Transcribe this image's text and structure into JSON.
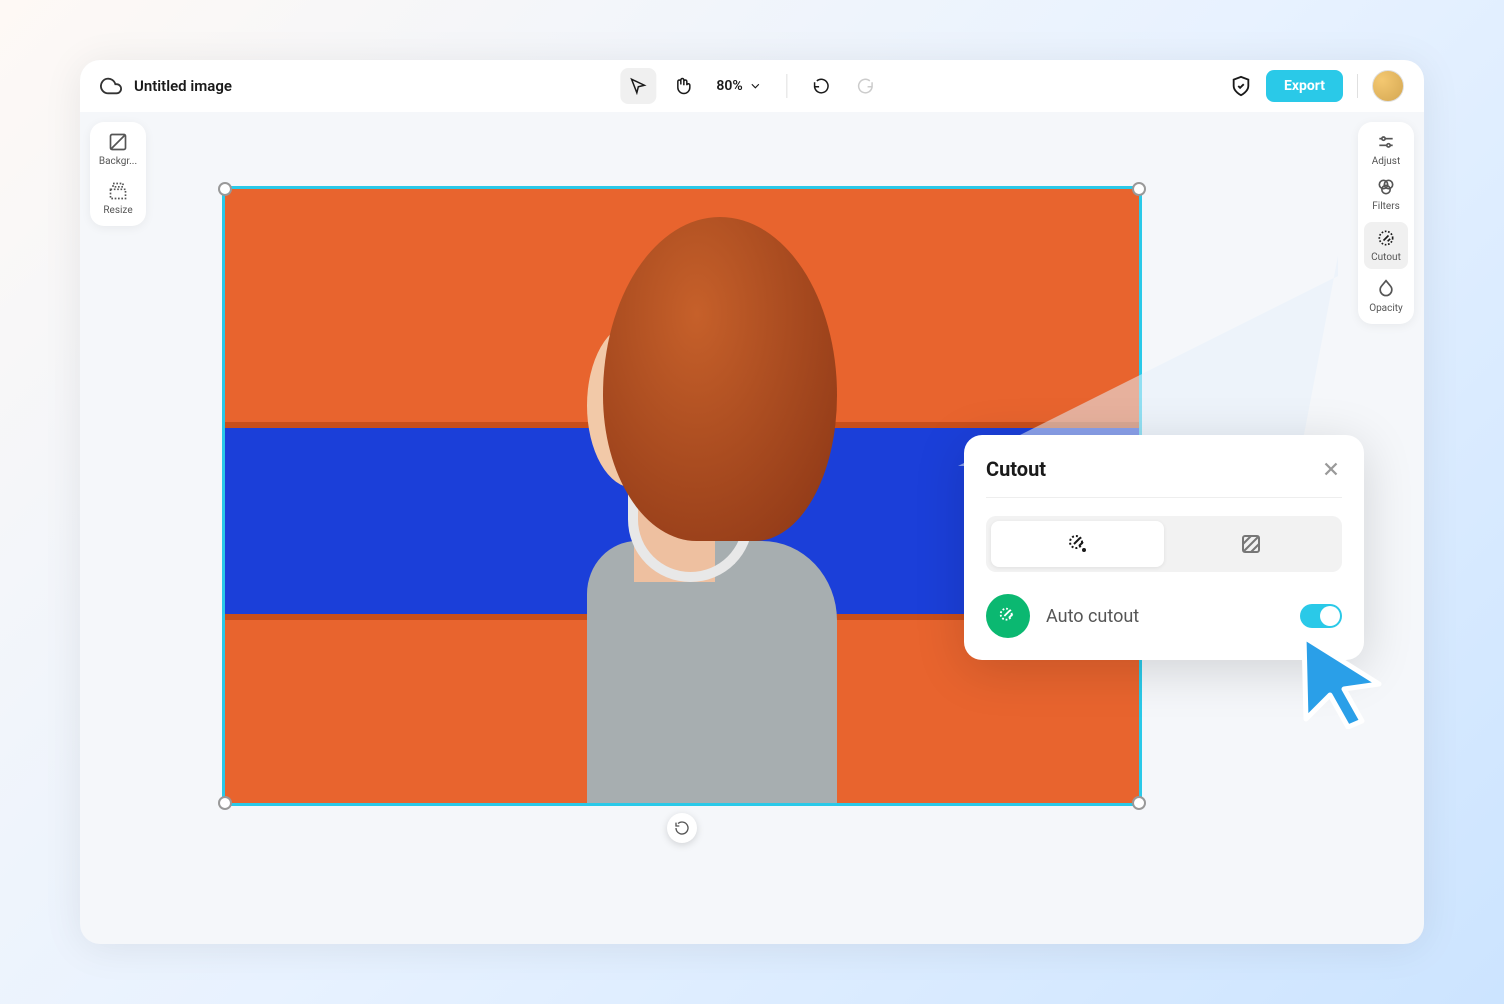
{
  "header": {
    "doc_title": "Untitled image",
    "zoom": "80%",
    "export_label": "Export"
  },
  "left_sidebar": {
    "background_label": "Backgr...",
    "resize_label": "Resize"
  },
  "right_sidebar": {
    "adjust_label": "Adjust",
    "filters_label": "Filters",
    "cutout_label": "Cutout",
    "opacity_label": "Opacity"
  },
  "cutout_panel": {
    "title": "Cutout",
    "auto_cutout_label": "Auto cutout",
    "toggle_on": true
  },
  "colors": {
    "accent": "#2ac9e8",
    "green": "#0bb871"
  }
}
